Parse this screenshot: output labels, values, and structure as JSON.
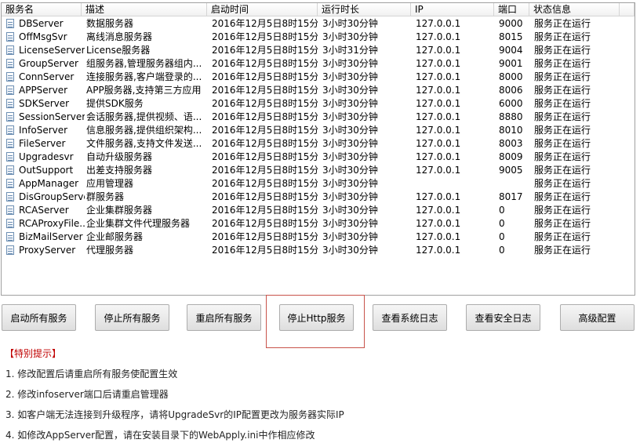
{
  "columns": [
    "服务名",
    "描述",
    "启动时间",
    "运行时长",
    "IP",
    "端口",
    "状态信息"
  ],
  "services": [
    {
      "name": "DBServer",
      "desc": "数据服务器",
      "start": "2016年12月5日8时15分",
      "uptime": "3小时30分钟",
      "ip": "127.0.0.1",
      "port": "9000",
      "status": "服务正在运行"
    },
    {
      "name": "OffMsgSvr",
      "desc": "离线消息服务器",
      "start": "2016年12月5日8时15分",
      "uptime": "3小时30分钟",
      "ip": "127.0.0.1",
      "port": "8015",
      "status": "服务正在运行"
    },
    {
      "name": "LicenseServer",
      "desc": "License服务器",
      "start": "2016年12月5日8时15分",
      "uptime": "3小时31分钟",
      "ip": "127.0.0.1",
      "port": "9004",
      "status": "服务正在运行"
    },
    {
      "name": "GroupServer",
      "desc": "组服务器,管理服务器组内...",
      "start": "2016年12月5日8时15分",
      "uptime": "3小时30分钟",
      "ip": "127.0.0.1",
      "port": "9001",
      "status": "服务正在运行"
    },
    {
      "name": "ConnServer",
      "desc": "连接服务器,客户端登录的...",
      "start": "2016年12月5日8时15分",
      "uptime": "3小时30分钟",
      "ip": "127.0.0.1",
      "port": "8000",
      "status": "服务正在运行"
    },
    {
      "name": "APPServer",
      "desc": "APP服务器,支持第三方应用",
      "start": "2016年12月5日8时15分",
      "uptime": "3小时30分钟",
      "ip": "127.0.0.1",
      "port": "8006",
      "status": "服务正在运行"
    },
    {
      "name": "SDKServer",
      "desc": "提供SDK服务",
      "start": "2016年12月5日8时15分",
      "uptime": "3小时30分钟",
      "ip": "127.0.0.1",
      "port": "6000",
      "status": "服务正在运行"
    },
    {
      "name": "SessionServer",
      "desc": "会话服务器,提供视频、语...",
      "start": "2016年12月5日8时15分",
      "uptime": "3小时30分钟",
      "ip": "127.0.0.1",
      "port": "8880",
      "status": "服务正在运行"
    },
    {
      "name": "InfoServer",
      "desc": "信息服务器,提供组织架构...",
      "start": "2016年12月5日8时15分",
      "uptime": "3小时30分钟",
      "ip": "127.0.0.1",
      "port": "8010",
      "status": "服务正在运行"
    },
    {
      "name": "FileServer",
      "desc": "文件服务器,支持文件发送...",
      "start": "2016年12月5日8时15分",
      "uptime": "3小时30分钟",
      "ip": "127.0.0.1",
      "port": "8003",
      "status": "服务正在运行"
    },
    {
      "name": "Upgradesvr",
      "desc": "自动升级服务器",
      "start": "2016年12月5日8时15分",
      "uptime": "3小时30分钟",
      "ip": "127.0.0.1",
      "port": "8009",
      "status": "服务正在运行"
    },
    {
      "name": "OutSupport",
      "desc": "出差支持服务器",
      "start": "2016年12月5日8时15分",
      "uptime": "3小时30分钟",
      "ip": "127.0.0.1",
      "port": "9005",
      "status": "服务正在运行"
    },
    {
      "name": "AppManager",
      "desc": "应用管理器",
      "start": "2016年12月5日8时15分",
      "uptime": "3小时30分钟",
      "ip": "",
      "port": "",
      "status": "服务正在运行"
    },
    {
      "name": "DisGroupServer",
      "desc": "群服务器",
      "start": "2016年12月5日8时15分",
      "uptime": "3小时30分钟",
      "ip": "127.0.0.1",
      "port": "8017",
      "status": "服务正在运行"
    },
    {
      "name": "RCAServer",
      "desc": "企业集群服务器",
      "start": "2016年12月5日8时15分",
      "uptime": "3小时30分钟",
      "ip": "127.0.0.1",
      "port": "0",
      "status": "服务正在运行"
    },
    {
      "name": "RCAProxyFile...",
      "desc": "企业集群文件代理服务器",
      "start": "2016年12月5日8时15分",
      "uptime": "3小时30分钟",
      "ip": "127.0.0.1",
      "port": "0",
      "status": "服务正在运行"
    },
    {
      "name": "BizMailServer",
      "desc": "企业邮服务器",
      "start": "2016年12月5日8时15分",
      "uptime": "3小时30分钟",
      "ip": "127.0.0.1",
      "port": "0",
      "status": "服务正在运行"
    },
    {
      "name": "ProxyServer",
      "desc": "代理服务器",
      "start": "2016年12月5日8时15分",
      "uptime": "3小时30分钟",
      "ip": "127.0.0.1",
      "port": "0",
      "status": "服务正在运行"
    }
  ],
  "buttons": {
    "start_all": "启动所有服务",
    "stop_all": "停止所有服务",
    "restart_all": "重启所有服务",
    "stop_http": "停止Http服务",
    "view_system_log": "查看系统日志",
    "view_security_log": "查看安全日志",
    "advanced_config": "高级配置"
  },
  "tips": {
    "title": "【特别提示】",
    "items": [
      "1. 修改配置后请重启所有服务使配置生效",
      "2. 修改infoserver端口后请重启管理器",
      "3. 如客户端无法连接到升级程序，请将UpgradeSvr的IP配置更改为服务器实际IP",
      "4. 如修改AppServer配置，请在安装目录下的WebApply.ini中作相应修改"
    ]
  },
  "colors": {
    "tips_title": "#c00000",
    "highlight_border": "#c8534a"
  }
}
